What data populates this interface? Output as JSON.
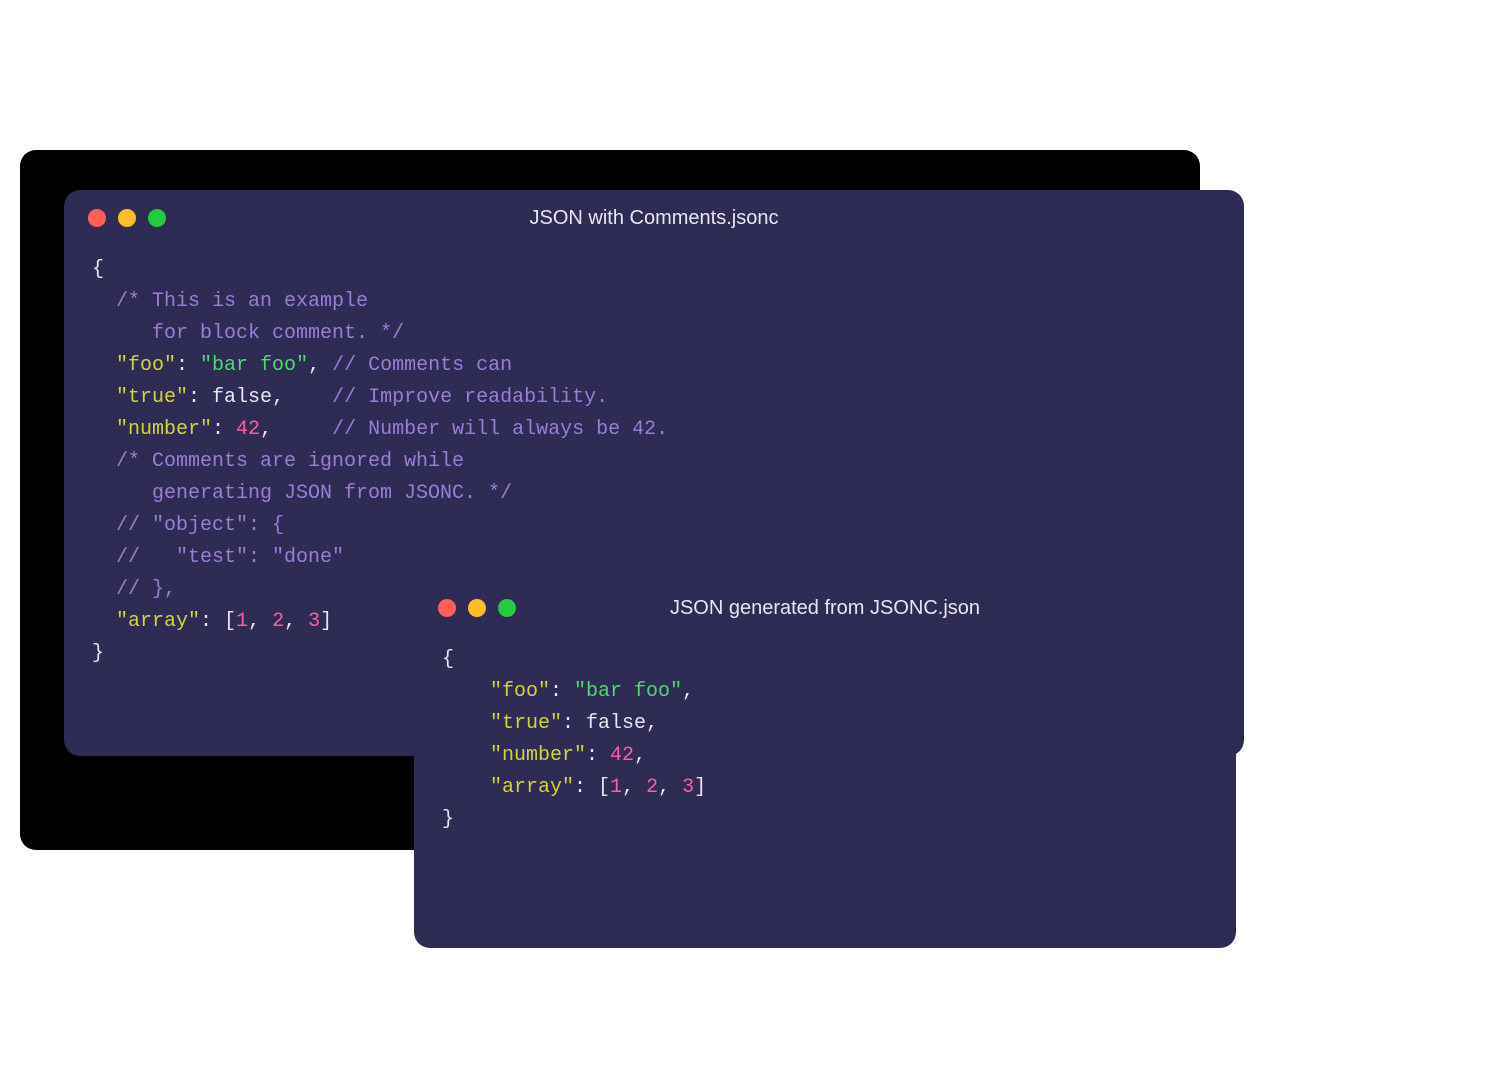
{
  "colors": {
    "bg_window": "#2e2b55",
    "traffic_red": "#ff5f56",
    "traffic_yellow": "#ffbd2e",
    "traffic_green": "#27c93f",
    "comment": "#9d7cd8",
    "key": "#d4d43a",
    "string": "#4fd870",
    "number": "#ff5f9e",
    "plain": "#e8e6f0"
  },
  "window1": {
    "title": "JSON with Comments.jsonc",
    "lines": [
      [
        {
          "t": "brace",
          "v": "{"
        }
      ],
      [
        {
          "t": "comment",
          "v": "  /* This is an example"
        }
      ],
      [
        {
          "t": "comment",
          "v": "     for block comment. */"
        }
      ],
      [
        {
          "t": "plain",
          "v": "  "
        },
        {
          "t": "key",
          "v": "\"foo\""
        },
        {
          "t": "punct",
          "v": ": "
        },
        {
          "t": "string",
          "v": "\"bar foo\""
        },
        {
          "t": "punct",
          "v": ", "
        },
        {
          "t": "comment",
          "v": "// Comments can"
        }
      ],
      [
        {
          "t": "plain",
          "v": "  "
        },
        {
          "t": "key",
          "v": "\"true\""
        },
        {
          "t": "punct",
          "v": ": "
        },
        {
          "t": "bool",
          "v": "false"
        },
        {
          "t": "punct",
          "v": ",    "
        },
        {
          "t": "comment",
          "v": "// Improve readability."
        }
      ],
      [
        {
          "t": "plain",
          "v": "  "
        },
        {
          "t": "key",
          "v": "\"number\""
        },
        {
          "t": "punct",
          "v": ": "
        },
        {
          "t": "number",
          "v": "42"
        },
        {
          "t": "punct",
          "v": ",     "
        },
        {
          "t": "comment",
          "v": "// Number will always be 42."
        }
      ],
      [
        {
          "t": "comment",
          "v": "  /* Comments are ignored while"
        }
      ],
      [
        {
          "t": "comment",
          "v": "     generating JSON from JSONC. */"
        }
      ],
      [
        {
          "t": "comment",
          "v": "  // \"object\": {"
        }
      ],
      [
        {
          "t": "comment",
          "v": "  //   \"test\": \"done\""
        }
      ],
      [
        {
          "t": "comment",
          "v": "  // },"
        }
      ],
      [
        {
          "t": "plain",
          "v": "  "
        },
        {
          "t": "key",
          "v": "\"array\""
        },
        {
          "t": "punct",
          "v": ": ["
        },
        {
          "t": "number",
          "v": "1"
        },
        {
          "t": "punct",
          "v": ", "
        },
        {
          "t": "number",
          "v": "2"
        },
        {
          "t": "punct",
          "v": ", "
        },
        {
          "t": "number",
          "v": "3"
        },
        {
          "t": "punct",
          "v": "]"
        }
      ],
      [
        {
          "t": "brace",
          "v": "}"
        }
      ]
    ]
  },
  "window2": {
    "title": "JSON generated from JSONC.json",
    "lines": [
      [
        {
          "t": "brace",
          "v": "{"
        }
      ],
      [
        {
          "t": "plain",
          "v": "    "
        },
        {
          "t": "key",
          "v": "\"foo\""
        },
        {
          "t": "punct",
          "v": ": "
        },
        {
          "t": "string",
          "v": "\"bar foo\""
        },
        {
          "t": "punct",
          "v": ","
        }
      ],
      [
        {
          "t": "plain",
          "v": "    "
        },
        {
          "t": "key",
          "v": "\"true\""
        },
        {
          "t": "punct",
          "v": ": "
        },
        {
          "t": "bool",
          "v": "false"
        },
        {
          "t": "punct",
          "v": ","
        }
      ],
      [
        {
          "t": "plain",
          "v": "    "
        },
        {
          "t": "key",
          "v": "\"number\""
        },
        {
          "t": "punct",
          "v": ": "
        },
        {
          "t": "number",
          "v": "42"
        },
        {
          "t": "punct",
          "v": ","
        }
      ],
      [
        {
          "t": "plain",
          "v": "    "
        },
        {
          "t": "key",
          "v": "\"array\""
        },
        {
          "t": "punct",
          "v": ": ["
        },
        {
          "t": "number",
          "v": "1"
        },
        {
          "t": "punct",
          "v": ", "
        },
        {
          "t": "number",
          "v": "2"
        },
        {
          "t": "punct",
          "v": ", "
        },
        {
          "t": "number",
          "v": "3"
        },
        {
          "t": "punct",
          "v": "]"
        }
      ],
      [
        {
          "t": "brace",
          "v": "}"
        }
      ]
    ]
  }
}
